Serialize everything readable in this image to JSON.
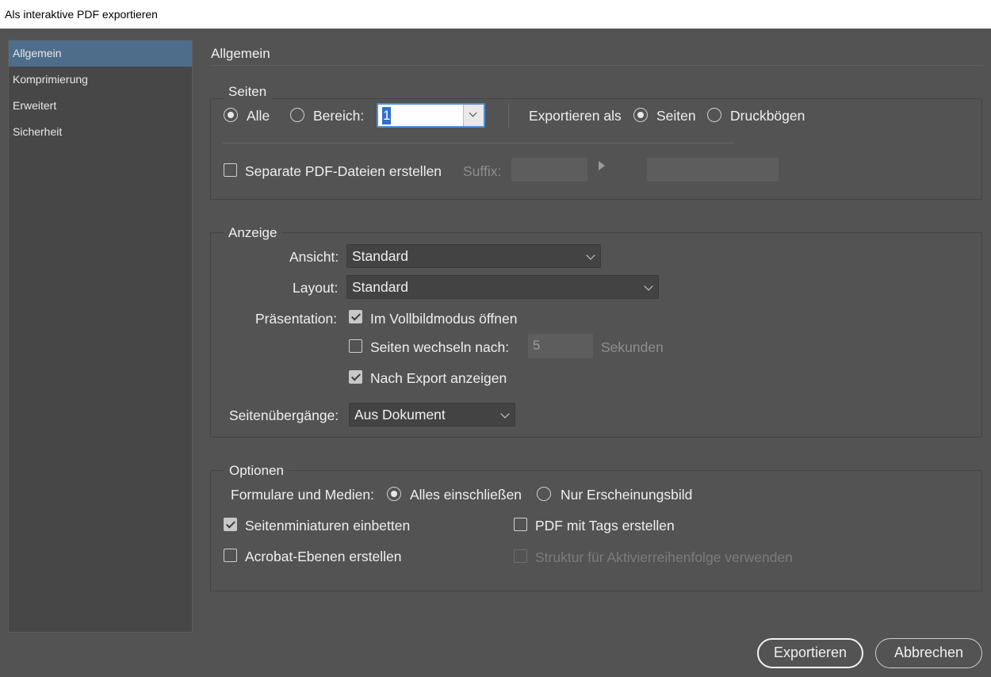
{
  "window": {
    "title": "Als interaktive PDF exportieren"
  },
  "sidebar": {
    "items": [
      {
        "label": "Allgemein",
        "selected": true
      },
      {
        "label": "Komprimierung"
      },
      {
        "label": "Erweitert"
      },
      {
        "label": "Sicherheit"
      }
    ]
  },
  "section_title": "Allgemein",
  "seiten": {
    "legend": "Seiten",
    "alle_label": "Alle",
    "bereich_label": "Bereich:",
    "bereich_value": "1",
    "exportieren_als_label": "Exportieren als",
    "export_seiten_label": "Seiten",
    "export_druckboegen_label": "Druckbögen",
    "separate_label": "Separate PDF-Dateien erstellen",
    "suffix_label": "Suffix:"
  },
  "anzeige": {
    "legend": "Anzeige",
    "ansicht_label": "Ansicht:",
    "ansicht_value": "Standard",
    "layout_label": "Layout:",
    "layout_value": "Standard",
    "praesentation_label": "Präsentation:",
    "vollbild_label": "Im Vollbildmodus öffnen",
    "seiten_wechseln_label": "Seiten wechseln nach:",
    "seiten_wechseln_value": "5",
    "sekunden_label": "Sekunden",
    "nach_export_label": "Nach Export anzeigen",
    "seitenuebergaenge_label": "Seitenübergänge:",
    "seitenuebergaenge_value": "Aus Dokument"
  },
  "optionen": {
    "legend": "Optionen",
    "formulare_label": "Formulare und Medien:",
    "alles_label": "Alles einschließen",
    "nur_label": "Nur Erscheinungsbild",
    "miniaturen_label": "Seitenminiaturen einbetten",
    "tags_label": "PDF mit Tags erstellen",
    "ebenen_label": "Acrobat-Ebenen erstellen",
    "struktur_label": "Struktur für Aktivierreihenfolge verwenden"
  },
  "buttons": {
    "export": "Exportieren",
    "cancel": "Abbrechen"
  }
}
